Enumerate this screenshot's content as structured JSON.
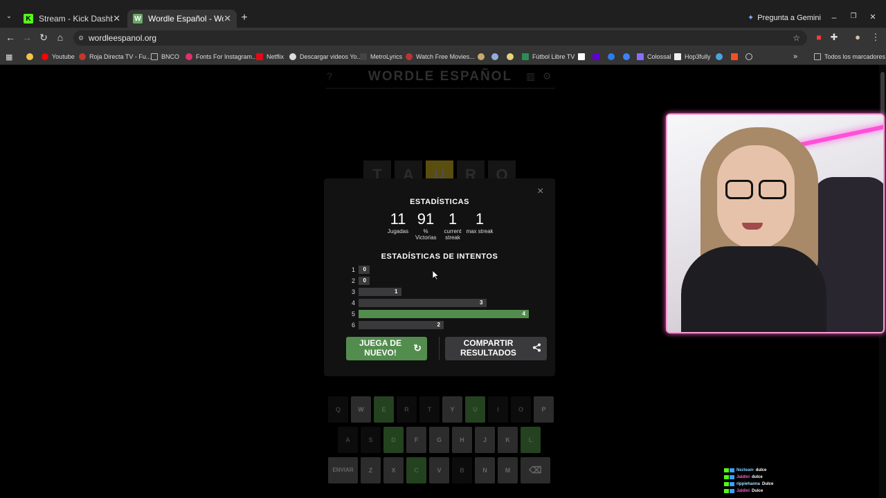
{
  "browser": {
    "tabs": [
      {
        "title": "Stream - Kick Dashboard",
        "favicon": "K",
        "color": "#53fc18",
        "active": false
      },
      {
        "title": "Wordle Español - Wordle ilimitado",
        "favicon": "W",
        "color": "#6aaa64",
        "active": true
      }
    ],
    "gemini_label": "Pregunta a Gemini",
    "url": "wordleespanol.org",
    "bookmarks": [
      "Youtube",
      "Roja Directa TV - Fu...",
      "BNCO",
      "Fonts For Instagram...",
      "Netflix",
      "Descargar videos Yo...",
      "MetroLyrics",
      "Watch Free Movies...",
      "Fútbol Libre TV",
      "Colossal",
      "Hop3fully"
    ],
    "all_bookmarks": "Todos los marcadores"
  },
  "game": {
    "title": "WORDLE ESPAÑOL",
    "guess_row": [
      {
        "letter": "T",
        "state": "absent"
      },
      {
        "letter": "A",
        "state": "absent"
      },
      {
        "letter": "U",
        "state": "present"
      },
      {
        "letter": "R",
        "state": "absent"
      },
      {
        "letter": "O",
        "state": "absent"
      }
    ]
  },
  "modal": {
    "close": "×",
    "stats_title": "ESTADÍSTICAS",
    "stats": [
      {
        "value": "11",
        "label": "Jugadas"
      },
      {
        "value": "91",
        "label": "% Victorias"
      },
      {
        "value": "1",
        "label": "current streak"
      },
      {
        "value": "1",
        "label": "max streak"
      }
    ],
    "dist_title": "ESTADÍSTICAS DE INTENTOS",
    "distribution": [
      {
        "guess": "1",
        "count": 0,
        "current": false
      },
      {
        "guess": "2",
        "count": 0,
        "current": false
      },
      {
        "guess": "3",
        "count": 1,
        "current": false
      },
      {
        "guess": "4",
        "count": 3,
        "current": false
      },
      {
        "guess": "5",
        "count": 4,
        "current": true
      },
      {
        "guess": "6",
        "count": 2,
        "current": false
      }
    ],
    "play_again": "JUEGA DE NUEVO!",
    "share": "COMPARTIR RESULTADOS",
    "refresh_icon": "↻",
    "share_icon": "share-icon"
  },
  "keyboard": {
    "row1": [
      [
        "Q",
        "absent"
      ],
      [
        "W",
        "used"
      ],
      [
        "E",
        "correct"
      ],
      [
        "R",
        "absent"
      ],
      [
        "T",
        "absent"
      ],
      [
        "Y",
        "used"
      ],
      [
        "U",
        "correct"
      ],
      [
        "I",
        "absent"
      ],
      [
        "O",
        "absent"
      ],
      [
        "P",
        "used"
      ]
    ],
    "row2": [
      [
        "A",
        "absent"
      ],
      [
        "S",
        "absent"
      ],
      [
        "D",
        "correct"
      ],
      [
        "F",
        "used"
      ],
      [
        "G",
        "used"
      ],
      [
        "H",
        "used"
      ],
      [
        "J",
        "used"
      ],
      [
        "K",
        "used"
      ],
      [
        "L",
        "correct"
      ]
    ],
    "row3": [
      [
        "ENVIAR",
        "used"
      ],
      [
        "Z",
        "used"
      ],
      [
        "X",
        "used"
      ],
      [
        "C",
        "correct"
      ],
      [
        "V",
        "used"
      ],
      [
        "B",
        "absent"
      ],
      [
        "N",
        "used"
      ],
      [
        "M",
        "used"
      ],
      [
        "⌫",
        "used"
      ]
    ]
  },
  "chat": [
    {
      "user": "Nezteam",
      "color": "#7fd3ff",
      "msg": "dulce"
    },
    {
      "user": "Jaldini",
      "color": "#ff5fd0",
      "msg": "dulce"
    },
    {
      "user": "rippiehanna",
      "color": "#a0e0ff",
      "msg": "Dulce"
    },
    {
      "user": "Jaldini",
      "color": "#ff5fd0",
      "msg": "Dulce"
    }
  ]
}
